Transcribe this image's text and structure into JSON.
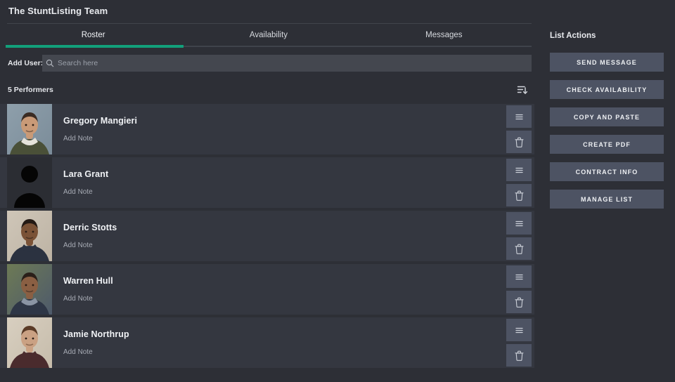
{
  "header": {
    "title": "The StuntListing Team"
  },
  "tabs": [
    {
      "label": "Roster",
      "active": true
    },
    {
      "label": "Availability",
      "active": false
    },
    {
      "label": "Messages",
      "active": false
    }
  ],
  "add_user": {
    "label": "Add User:",
    "search_value": "",
    "search_placeholder": "Search here",
    "icon": "search-icon"
  },
  "list": {
    "count_label": "5 Performers",
    "sort_icon": "sort-descending-icon",
    "row_actions": {
      "drag_icon": "hamburger-drag-handle-icon",
      "delete_icon": "trash-icon"
    },
    "note_label": "Add Note",
    "performers": [
      {
        "name": "Gregory Mangieri",
        "note": "Add Note",
        "avatar": "photo"
      },
      {
        "name": "Lara Grant",
        "note": "Add Note",
        "avatar": "placeholder"
      },
      {
        "name": "Derric Stotts",
        "note": "Add Note",
        "avatar": "photo"
      },
      {
        "name": "Warren Hull",
        "note": "Add Note",
        "avatar": "photo"
      },
      {
        "name": "Jamie Northrup",
        "note": "Add Note",
        "avatar": "photo"
      }
    ]
  },
  "sidebar": {
    "title": "List Actions",
    "buttons": [
      {
        "label": "Send Message"
      },
      {
        "label": "Check Availability"
      },
      {
        "label": "Copy and Paste"
      },
      {
        "label": "Create PDF"
      },
      {
        "label": "Contract Info"
      },
      {
        "label": "Manage List"
      }
    ]
  },
  "colors": {
    "page_background": "#2d2f36",
    "row_background": "#343740",
    "accent_green": "#12a07b",
    "button_slate": "#4d5363",
    "search_field": "#44474f",
    "text_primary": "#f0f2f5",
    "text_muted": "#a7abb4"
  }
}
